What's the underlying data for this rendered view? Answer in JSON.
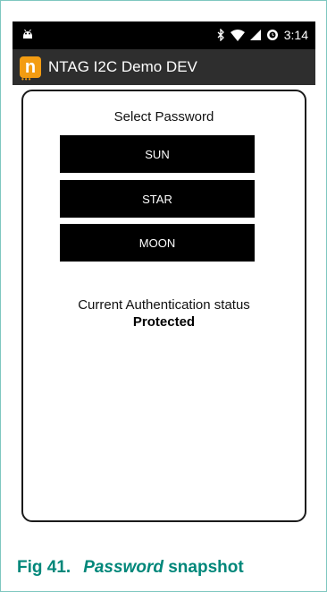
{
  "status_bar": {
    "time": "3:14",
    "icons": [
      "android-debug-icon",
      "bluetooth-icon",
      "wifi-icon",
      "signal-icon",
      "alarm-icon"
    ]
  },
  "action_bar": {
    "title": "NTAG I2C Demo DEV",
    "logo_letter": "n",
    "logo_dots": "•••",
    "logo_color": "#f39c12"
  },
  "main": {
    "select_label": "Select Password",
    "buttons": [
      {
        "label": "SUN"
      },
      {
        "label": "STAR"
      },
      {
        "label": "MOON"
      }
    ],
    "auth_label": "Current Authentication status",
    "auth_status": "Protected"
  },
  "caption": {
    "number": "Fig 41.",
    "emphasis": "Password",
    "rest": " snapshot",
    "color": "#00877a"
  }
}
